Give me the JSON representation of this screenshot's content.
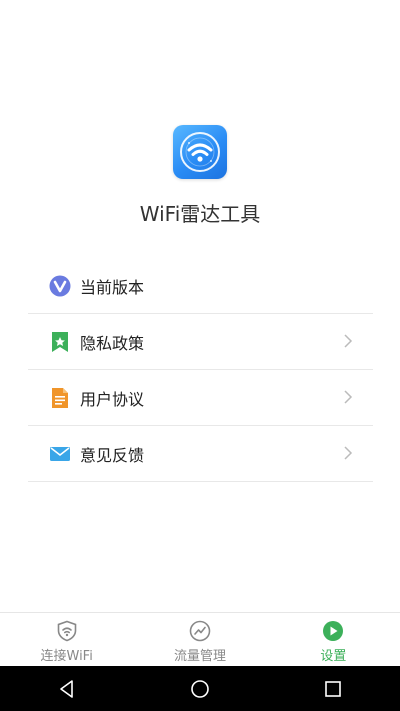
{
  "app": {
    "name": "WiFi雷达工具",
    "icon": "wifi-radar-icon"
  },
  "menu": {
    "items": [
      {
        "label": "当前版本",
        "icon": "version-v-icon",
        "color": "#5b6bd6",
        "has_chevron": false
      },
      {
        "label": "隐私政策",
        "icon": "bookmark-star-icon",
        "color": "#3cb05a",
        "has_chevron": true
      },
      {
        "label": "用户协议",
        "icon": "document-icon",
        "color": "#f0952a",
        "has_chevron": true
      },
      {
        "label": "意见反馈",
        "icon": "envelope-icon",
        "color": "#3aa6e8",
        "has_chevron": true
      }
    ]
  },
  "bottom_nav": {
    "tabs": [
      {
        "label": "连接WiFi",
        "icon": "shield-wifi-icon",
        "active": false
      },
      {
        "label": "流量管理",
        "icon": "traffic-chart-icon",
        "active": false
      },
      {
        "label": "设置",
        "icon": "play-circle-icon",
        "active": true
      }
    ]
  },
  "system_nav": {
    "buttons": [
      "back-icon",
      "home-icon",
      "recents-icon"
    ]
  },
  "colors": {
    "active": "#3cb05a",
    "inactive": "#888888",
    "divider": "#e8e8e8"
  }
}
